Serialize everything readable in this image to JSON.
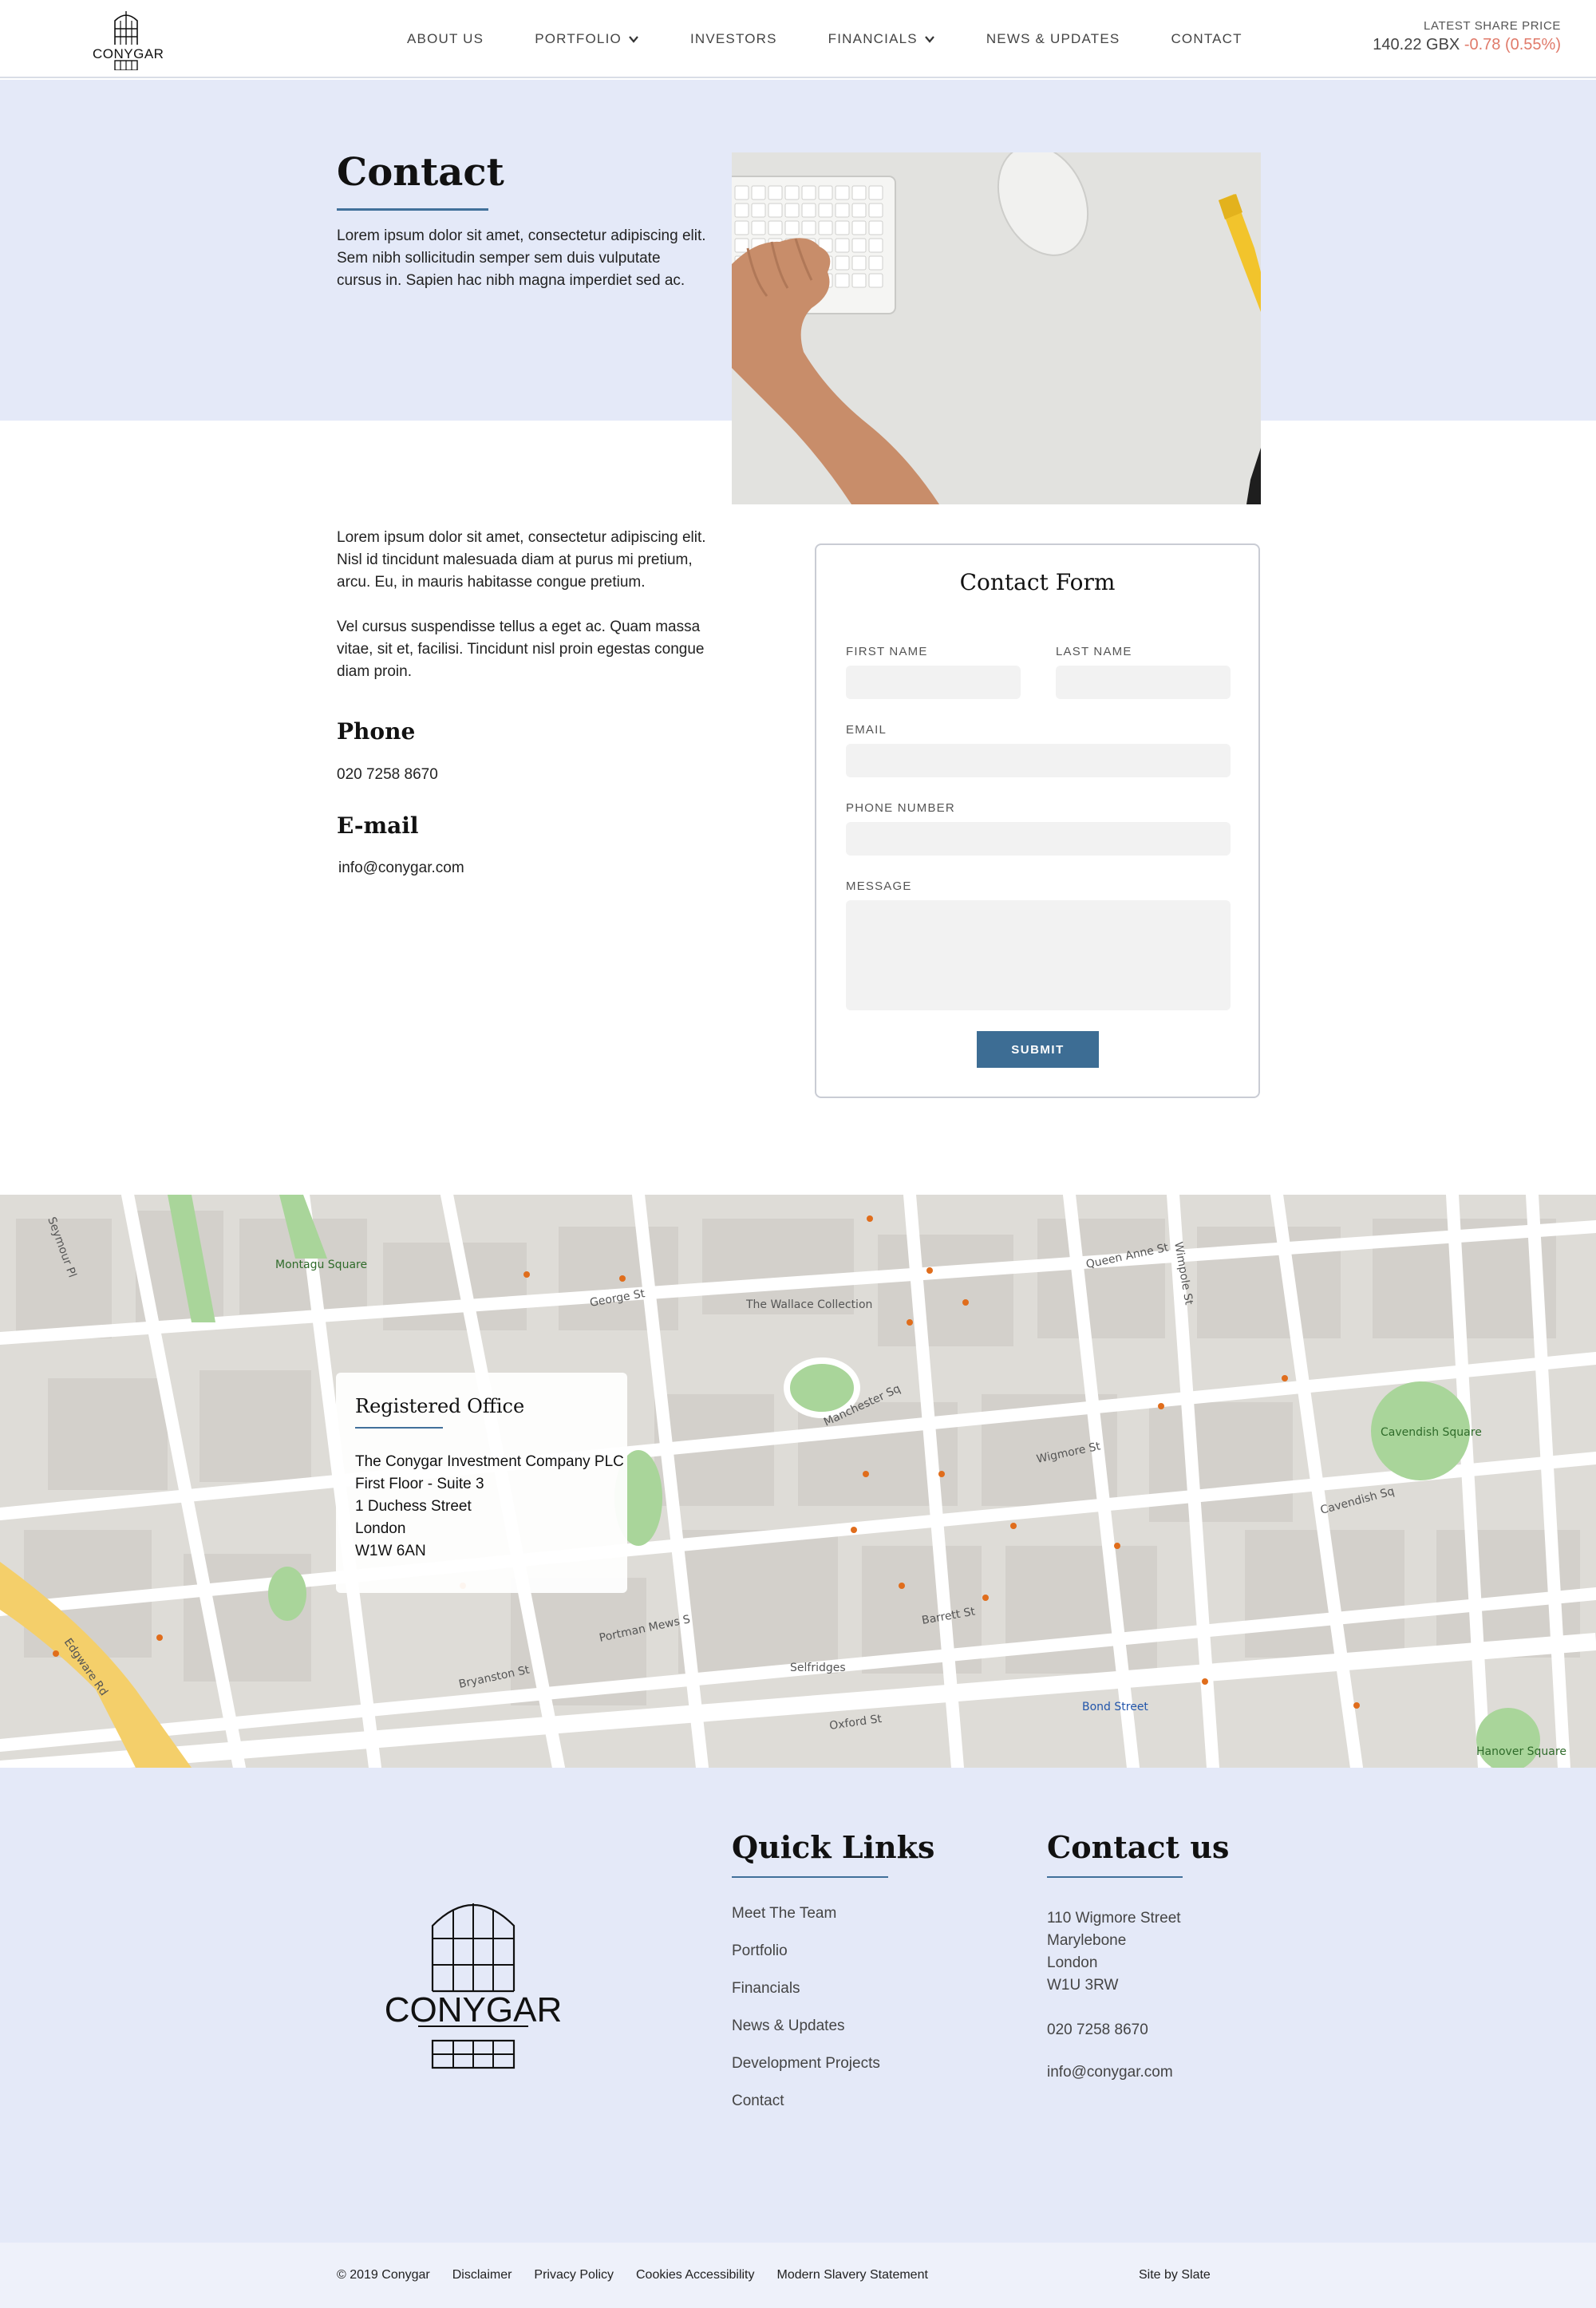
{
  "header": {
    "logo_text": "CONYGAR",
    "nav": [
      {
        "label": "ABOUT US",
        "dropdown": false
      },
      {
        "label": "PORTFOLIO",
        "dropdown": true
      },
      {
        "label": "INVESTORS",
        "dropdown": false
      },
      {
        "label": "FINANCIALS",
        "dropdown": true
      },
      {
        "label": "NEWS & UPDATES",
        "dropdown": false
      },
      {
        "label": "CONTACT",
        "dropdown": false
      }
    ],
    "share": {
      "label": "LATEST SHARE PRICE",
      "price": "140.22 GBX",
      "change": "-0.78 (0.55%)"
    }
  },
  "hero": {
    "title": "Contact",
    "text": "Lorem ipsum dolor sit amet, consectetur adipiscing elit. Sem nibh sollicitudin semper sem duis vulputate cursus in. Sapien hac nibh magna imperdiet sed ac."
  },
  "info": {
    "paragraphs": [
      "Lorem ipsum dolor sit amet, consectetur adipiscing elit. Nisl id tincidunt malesuada diam at purus mi pretium, arcu. Eu, in mauris habitasse congue pretium.",
      "Vel cursus suspendisse tellus a eget ac. Quam massa vitae, sit et, facilisi. Tincidunt nisl proin egestas congue diam proin."
    ],
    "phone_heading": "Phone",
    "phone": "020 7258 8670",
    "email_heading": "E-mail",
    "email": "info@conygar.com"
  },
  "form": {
    "title": "Contact Form",
    "first_name_label": "FIRST NAME",
    "last_name_label": "LAST NAME",
    "email_label": "EMAIL",
    "phone_label": "PHONE NUMBER",
    "message_label": "MESSAGE",
    "first_name_value": "",
    "last_name_value": "",
    "email_value": "",
    "phone_value": "",
    "message_value": "",
    "submit_label": "SUBMIT"
  },
  "map": {
    "office": {
      "title": "Registered Office",
      "lines": [
        "The Conygar Investment Company PLC",
        "First Floor - Suite 3",
        "1 Duchess Street",
        "London",
        "W1W 6AN"
      ]
    },
    "labels": {
      "wigmore_st": "Wigmore St",
      "oxford_st": "Oxford St",
      "cavendish_sq": "Cavendish Square",
      "edgware_rd": "Edgware Rd",
      "george_st": "George St",
      "manchester_sq": "Manchester Sq",
      "montagu_sq": "Montagu Square",
      "bond_street": "Bond Street",
      "selfridges": "Selfridges",
      "wallace": "The Wallace Collection",
      "hanover_sq": "Hanover Square",
      "portman_mews": "Portman Mews S",
      "bryanston_st": "Bryanston St",
      "seymour_pl": "Seymour Pl",
      "wimpole_st": "Wimpole St",
      "cavendish_sq_st": "Cavendish Sq",
      "barrett_st": "Barrett St",
      "queen_anne_st": "Queen Anne St"
    }
  },
  "footer": {
    "logo_text": "CONYGAR",
    "quick_links_title": "Quick Links",
    "quick_links": [
      "Meet The Team",
      "Portfolio",
      "Financials",
      "News & Updates",
      "Development Projects",
      "Contact"
    ],
    "contact_title": "Contact us",
    "address": [
      "110 Wigmore Street",
      "Marylebone",
      "London",
      "W1U 3RW"
    ],
    "phone": "020 7258 8670",
    "email": "info@conygar.com",
    "bottom_links": [
      "© 2019 Conygar",
      "Disclaimer",
      "Privacy Policy",
      "Cookies Accessibility",
      "Modern Slavery Statement"
    ],
    "site_by": "Site by Slate"
  }
}
